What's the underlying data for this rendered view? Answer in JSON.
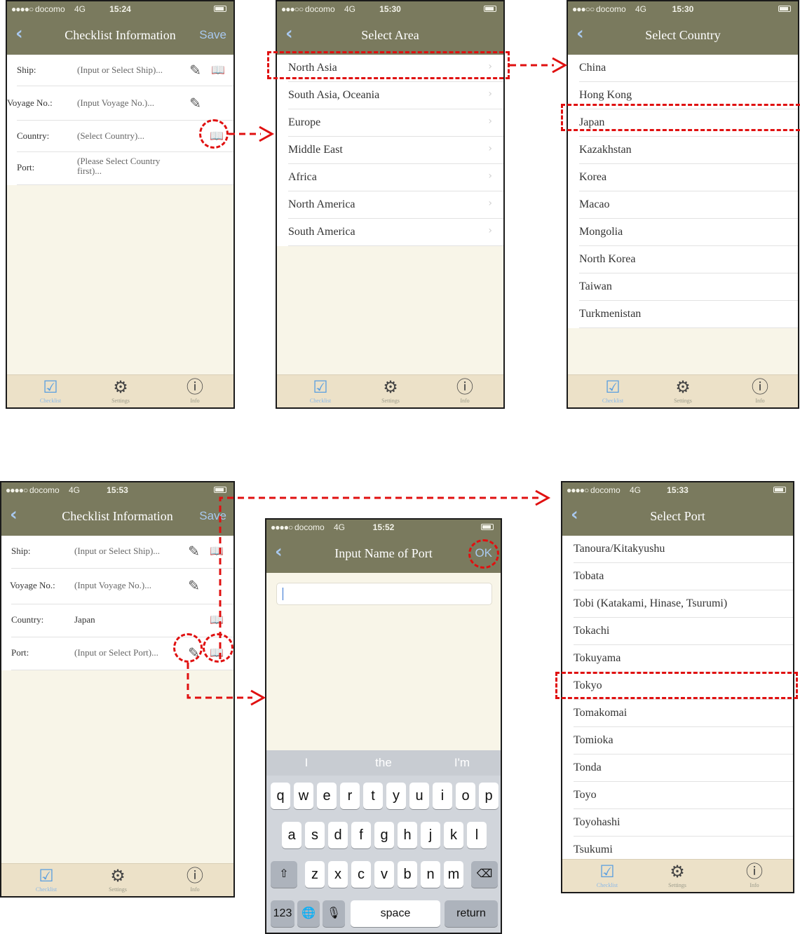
{
  "screens": {
    "s1": {
      "status": {
        "signal": "●●●●○",
        "carrier": "docomo",
        "network": "4G",
        "time": "15:24"
      },
      "nav": {
        "title": "Checklist Information",
        "save": "Save"
      },
      "fields": [
        {
          "label": "Ship:",
          "value": "(Input or Select Ship)..."
        },
        {
          "label": "Voyage No.:",
          "value": "(Input Voyage No.)..."
        },
        {
          "label": "Country:",
          "value": "(Select Country)..."
        },
        {
          "label": "Port:",
          "value": "(Please Select Country first)..."
        }
      ]
    },
    "s2": {
      "status": {
        "signal": "●●●○○",
        "carrier": "docomo",
        "network": "4G",
        "time": "15:30"
      },
      "nav": {
        "title": "Select Area"
      },
      "items": [
        "North Asia",
        "South Asia, Oceania",
        "Europe",
        "Middle East",
        "Africa",
        "North America",
        "South America"
      ]
    },
    "s3": {
      "status": {
        "signal": "●●●○○",
        "carrier": "docomo",
        "network": "4G",
        "time": "15:30"
      },
      "nav": {
        "title": "Select Country"
      },
      "items": [
        "China",
        "Hong Kong",
        "Japan",
        "Kazakhstan",
        "Korea",
        "Macao",
        "Mongolia",
        "North Korea",
        "Taiwan",
        "Turkmenistan"
      ]
    },
    "s4": {
      "status": {
        "signal": "●●●●○",
        "carrier": "docomo",
        "network": "4G",
        "time": "15:53"
      },
      "nav": {
        "title": "Checklist Information",
        "save": "Save"
      },
      "fields": [
        {
          "label": "Ship:",
          "value": "(Input or Select Ship)..."
        },
        {
          "label": "Voyage No.:",
          "value": "(Input Voyage No.)..."
        },
        {
          "label": "Country:",
          "value": "Japan"
        },
        {
          "label": "Port:",
          "value": "(Input or Select Port)..."
        }
      ]
    },
    "s5": {
      "status": {
        "signal": "●●●●○",
        "carrier": "docomo",
        "network": "4G",
        "time": "15:52"
      },
      "nav": {
        "title": "Input Name of Port",
        "ok": "OK"
      },
      "keyboard": {
        "suggestions": [
          "I",
          "the",
          "I'm"
        ],
        "row1": [
          "q",
          "w",
          "e",
          "r",
          "t",
          "y",
          "u",
          "i",
          "o",
          "p"
        ],
        "row2": [
          "a",
          "s",
          "d",
          "f",
          "g",
          "h",
          "j",
          "k",
          "l"
        ],
        "row3": [
          "z",
          "x",
          "c",
          "v",
          "b",
          "n",
          "m"
        ],
        "shift": "⇧",
        "backspace": "⌫",
        "numbers": "123",
        "globe": "🌐",
        "mic": "🎙",
        "space": "space",
        "return": "return"
      }
    },
    "s6": {
      "status": {
        "signal": "●●●●○",
        "carrier": "docomo",
        "network": "4G",
        "time": "15:33"
      },
      "nav": {
        "title": "Select Port"
      },
      "items": [
        "Tanoura/Kitakyushu",
        "Tobata",
        "Tobi (Katakami, Hinase, Tsurumi)",
        "Tokachi",
        "Tokuyama",
        "Tokyo",
        "Tomakomai",
        "Tomioka",
        "Tonda",
        "Toyo",
        "Toyohashi",
        "Tsukumi"
      ]
    }
  },
  "tabs": {
    "checklist": "Checklist",
    "settings": "Settings",
    "info": "Info"
  },
  "icons": {
    "edit": "pencil-edit-icon",
    "book": "open-book-icon",
    "gear": "gear-icon",
    "info": "info-icon",
    "check": "checkbox-icon",
    "back": "chevron-left-icon",
    "chevron": "chevron-right-icon"
  },
  "colors": {
    "navbar": "#7a7a5e",
    "background": "#f8f5e8",
    "tabbar": "#ece1c8",
    "accent": "#a8c8ee",
    "highlight": "#e01010"
  }
}
